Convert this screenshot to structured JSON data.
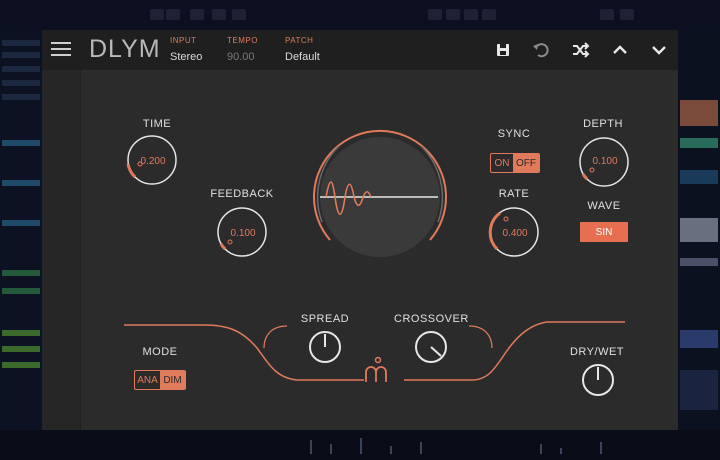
{
  "plugin": {
    "brand": "DLYM",
    "input": {
      "label": "INPUT",
      "value": "Stereo"
    },
    "tempo": {
      "label": "TEMPO",
      "value": "90.00"
    },
    "patch": {
      "label": "PATCH",
      "value": "Default"
    }
  },
  "knobs": {
    "time": {
      "label": "TIME",
      "value": "0.200",
      "level": 0.2
    },
    "feedback": {
      "label": "FEEDBACK",
      "value": "0.100",
      "level": 0.1
    },
    "rate": {
      "label": "RATE",
      "value": "0.400",
      "level": 0.4
    },
    "depth": {
      "label": "DEPTH",
      "value": "0.100",
      "level": 0.1
    },
    "spread": {
      "label": "SPREAD"
    },
    "crossover": {
      "label": "CROSSOVER"
    },
    "drywet": {
      "label": "DRY/WET"
    }
  },
  "sync": {
    "label": "SYNC",
    "on": "ON",
    "off": "OFF",
    "selected": "OFF"
  },
  "wave": {
    "label": "WAVE",
    "value": "SIN"
  },
  "mode": {
    "label": "MODE",
    "ana": "ANA",
    "dim": "DIM",
    "selected": "DIM"
  },
  "colors": {
    "accent": "#e07a5a",
    "panel": "#2b2b2b",
    "topbar": "#1f1f1f"
  },
  "icons": [
    "menu-icon",
    "save-icon",
    "undo-icon",
    "shuffle-icon",
    "chevron-up-icon",
    "chevron-down-icon",
    "logo-icon"
  ]
}
